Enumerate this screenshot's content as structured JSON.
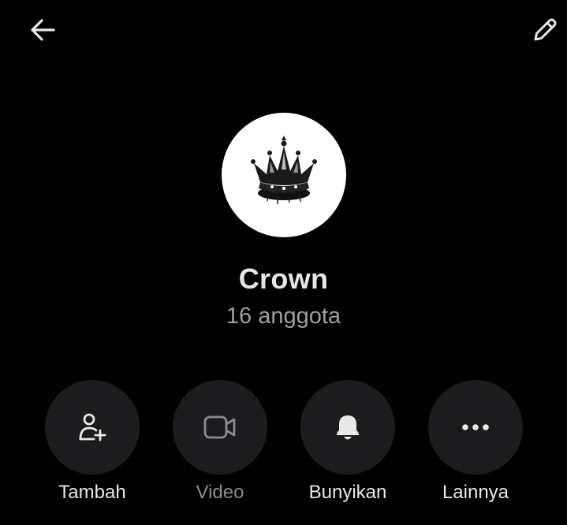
{
  "header": {
    "back_icon": "arrow-left-icon",
    "edit_icon": "pencil-icon"
  },
  "group": {
    "name": "Crown",
    "members": "16 anggota",
    "avatar_icon": "crown-icon"
  },
  "actions": [
    {
      "label": "Tambah",
      "icon": "add-person-icon",
      "enabled": true
    },
    {
      "label": "Video",
      "icon": "video-camera-icon",
      "enabled": false
    },
    {
      "label": "Bunyikan",
      "icon": "bell-icon",
      "enabled": true
    },
    {
      "label": "Lainnya",
      "icon": "more-dots-icon",
      "enabled": true
    }
  ],
  "colors": {
    "background": "#000000",
    "button_bg": "#1c1c1e",
    "text": "#e8e8e8",
    "muted": "#9d9fa4"
  }
}
